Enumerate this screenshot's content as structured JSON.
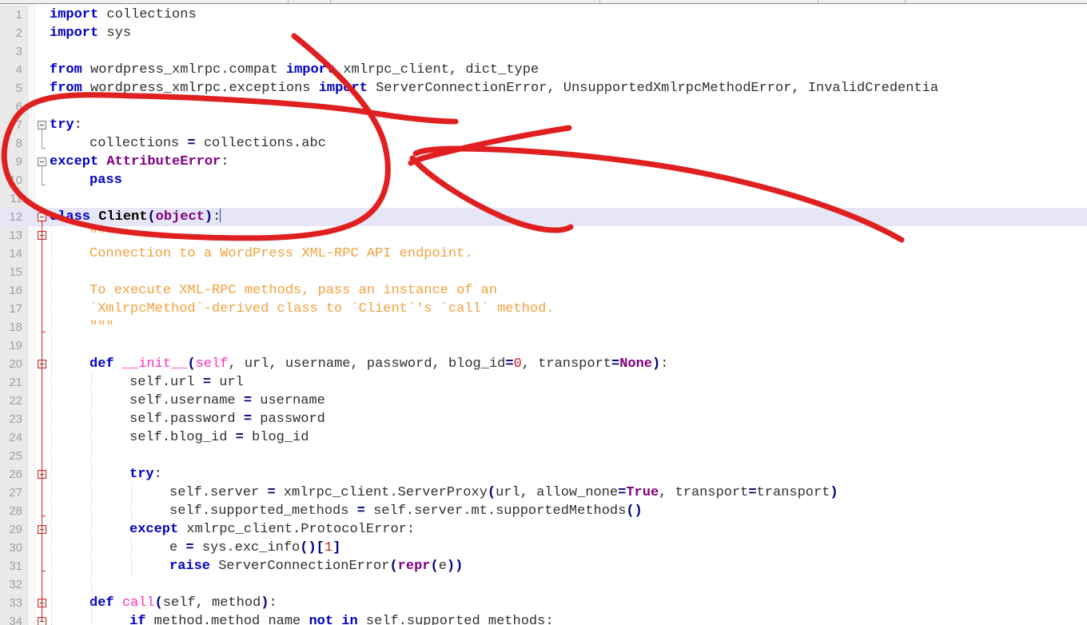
{
  "app": {
    "kind": "code-editor",
    "language": "Python",
    "cursor_line": 12,
    "highlight_line": 12
  },
  "colors": {
    "background": "#ffffff",
    "gutter": "#e9e9e9",
    "line_number": "#a0a0a0",
    "current_line_highlight": "#e6e6f7",
    "keyword": "#0000c8",
    "exception": "#800080",
    "function": "#ff2fbf",
    "docstring": "#f2a13c",
    "number": "#d02020",
    "operator": "#000080",
    "annotation_red": "#e02020",
    "fold_marker_red": "#cc2222"
  },
  "editor": {
    "first_line": 1,
    "last_line": 34,
    "line_height": 23,
    "lines": [
      {
        "n": 1,
        "indent": 0,
        "text": "import collections"
      },
      {
        "n": 2,
        "indent": 0,
        "text": "import sys"
      },
      {
        "n": 3,
        "indent": 0,
        "text": ""
      },
      {
        "n": 4,
        "indent": 0,
        "text": "from wordpress_xmlrpc.compat import xmlrpc_client, dict_type"
      },
      {
        "n": 5,
        "indent": 0,
        "text": "from wordpress_xmlrpc.exceptions import ServerConnectionError, UnsupportedXmlrpcMethodError, InvalidCredentia"
      },
      {
        "n": 6,
        "indent": 0,
        "text": ""
      },
      {
        "n": 7,
        "indent": 0,
        "text": "try:"
      },
      {
        "n": 8,
        "indent": 1,
        "text": "collections = collections.abc"
      },
      {
        "n": 9,
        "indent": 0,
        "text": "except AttributeError:"
      },
      {
        "n": 10,
        "indent": 1,
        "text": "pass"
      },
      {
        "n": 11,
        "indent": 0,
        "text": ""
      },
      {
        "n": 12,
        "indent": 0,
        "text": "class Client(object):"
      },
      {
        "n": 13,
        "indent": 1,
        "text": "\"\"\""
      },
      {
        "n": 14,
        "indent": 1,
        "text": "Connection to a WordPress XML-RPC API endpoint."
      },
      {
        "n": 15,
        "indent": 0,
        "text": ""
      },
      {
        "n": 16,
        "indent": 1,
        "text": "To execute XML-RPC methods, pass an instance of an"
      },
      {
        "n": 17,
        "indent": 1,
        "text": "`XmlrpcMethod`-derived class to `Client`'s `call` method."
      },
      {
        "n": 18,
        "indent": 1,
        "text": "\"\"\""
      },
      {
        "n": 19,
        "indent": 0,
        "text": ""
      },
      {
        "n": 20,
        "indent": 1,
        "text": "def __init__(self, url, username, password, blog_id=0, transport=None):"
      },
      {
        "n": 21,
        "indent": 2,
        "text": "self.url = url"
      },
      {
        "n": 22,
        "indent": 2,
        "text": "self.username = username"
      },
      {
        "n": 23,
        "indent": 2,
        "text": "self.password = password"
      },
      {
        "n": 24,
        "indent": 2,
        "text": "self.blog_id = blog_id"
      },
      {
        "n": 25,
        "indent": 0,
        "text": ""
      },
      {
        "n": 26,
        "indent": 2,
        "text": "try:"
      },
      {
        "n": 27,
        "indent": 3,
        "text": "self.server = xmlrpc_client.ServerProxy(url, allow_none=True, transport=transport)"
      },
      {
        "n": 28,
        "indent": 3,
        "text": "self.supported_methods = self.server.mt.supportedMethods()"
      },
      {
        "n": 29,
        "indent": 2,
        "text": "except xmlrpc_client.ProtocolError:"
      },
      {
        "n": 30,
        "indent": 3,
        "text": "e = sys.exc_info()[1]"
      },
      {
        "n": 31,
        "indent": 3,
        "text": "raise ServerConnectionError(repr(e))"
      },
      {
        "n": 32,
        "indent": 0,
        "text": ""
      },
      {
        "n": 33,
        "indent": 1,
        "text": "def call(self, method):"
      },
      {
        "n": 34,
        "indent": 2,
        "text": "if method.method_name not in self.supported_methods:"
      }
    ],
    "fold_markers": [
      {
        "line": 7,
        "style": "gray"
      },
      {
        "line": 9,
        "style": "gray"
      },
      {
        "line": 12,
        "style": "red"
      },
      {
        "line": 13,
        "style": "red"
      },
      {
        "line": 20,
        "style": "red"
      },
      {
        "line": 26,
        "style": "red"
      },
      {
        "line": 29,
        "style": "red"
      },
      {
        "line": 33,
        "style": "red"
      },
      {
        "line": 34,
        "style": "red"
      }
    ]
  },
  "annotations": {
    "color": "#e02020",
    "items": [
      {
        "name": "circle-around-try-except-class",
        "shape": "ellipse",
        "targets": "lines 6-13"
      },
      {
        "name": "arrow-pointing-left",
        "shape": "arrow",
        "direction": "left",
        "points_to": "circled try/except block"
      }
    ]
  }
}
